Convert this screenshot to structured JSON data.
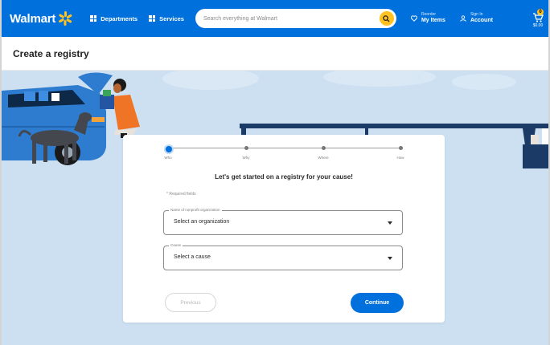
{
  "header": {
    "logo_text": "Walmart",
    "departments_label": "Departments",
    "services_label": "Services",
    "search_placeholder": "Search everything at Walmart",
    "store_small": "Reorder",
    "store_big": "My Items",
    "account_small": "Sign In",
    "account_big": "Account",
    "cart_count": "0",
    "cart_label": "$0.00"
  },
  "page": {
    "title": "Create a registry"
  },
  "stepper": {
    "steps": [
      "Who",
      "Why",
      "Where",
      "How"
    ],
    "active_index": 0
  },
  "form": {
    "heading": "Let's get started on a registry for your cause!",
    "required_note": "* Required fields",
    "org_legend": "Name of nonprofit organization",
    "org_value": "Select an organization",
    "cause_legend": "Cause",
    "cause_value": "Select a cause"
  },
  "buttons": {
    "previous": "Previous",
    "continue": "Continue"
  },
  "colors": {
    "brand_blue": "#0071dc",
    "spark_yellow": "#ffc220",
    "hero_bg": "#cde0f2",
    "car_blue": "#2e7cd0",
    "table_navy": "#1c3a66"
  }
}
